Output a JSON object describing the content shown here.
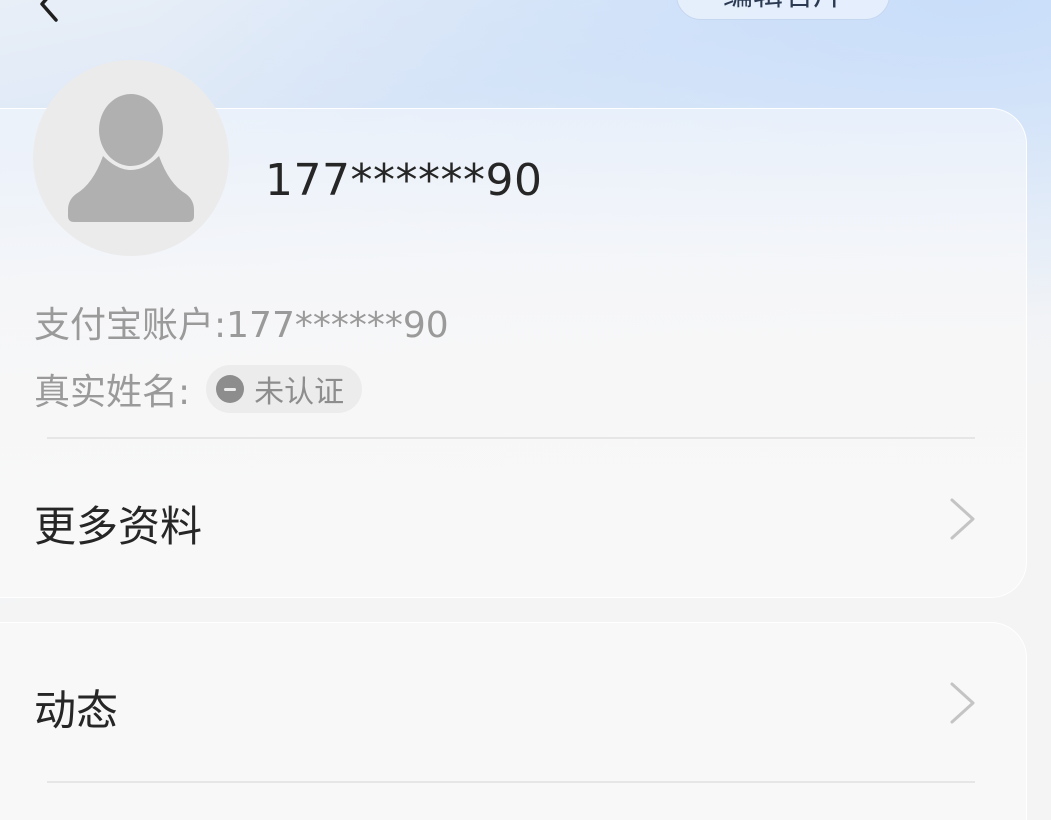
{
  "header": {
    "back_icon": "chevron-left-icon",
    "edit_button_label": "编辑名片"
  },
  "profile": {
    "avatar_icon": "default-user-avatar-icon",
    "display_name": "177******90",
    "account_line": "支付宝账户:177******90",
    "real_name_label": "真实姓名:",
    "verify_icon": "minus-circle-icon",
    "verify_status": "未认证",
    "more_info_label": "更多资料",
    "chevron_icon": "chevron-right-icon"
  },
  "feed": {
    "moments_label": "动态",
    "chevron_icon": "chevron-right-icon"
  },
  "colors": {
    "accent_blue": "#c9defa",
    "card_bg": "#f8f8f8",
    "text_primary": "#262626",
    "text_secondary": "#9a9a9a"
  }
}
